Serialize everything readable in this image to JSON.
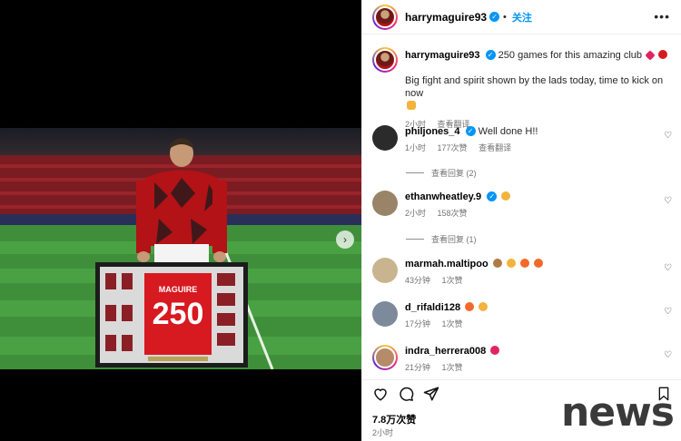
{
  "header": {
    "username": "harrymaguire93",
    "follow_label": "关注",
    "more_label": "•••"
  },
  "caption": {
    "username": "harrymaguire93",
    "headline": "250 games for this amazing club",
    "body": "Big fight and spirit shown by the lads today, time to kick on now",
    "time": "2小时",
    "translate": "查看翻译"
  },
  "comments": [
    {
      "username": "philjones_4",
      "text": "Well done H!!",
      "time": "1小时",
      "likes": "177次赞",
      "extra": "查看翻译",
      "replies": "查看回复 (2)"
    },
    {
      "username": "ethanwheatley.9",
      "text": "",
      "time": "2小时",
      "likes": "158次赞",
      "extra": "",
      "replies": "查看回复 (1)"
    },
    {
      "username": "marmah.maltipoo",
      "text": "",
      "time": "43分钟",
      "likes": "1次赞",
      "extra": ""
    },
    {
      "username": "d_rifaldi128",
      "text": "",
      "time": "17分钟",
      "likes": "1次赞",
      "extra": ""
    },
    {
      "username": "indra_herrera008",
      "text": "",
      "time": "21分钟",
      "likes": "1次赞",
      "extra": ""
    }
  ],
  "post": {
    "likes": "7.8万次赞",
    "time": "2小时"
  },
  "photo": {
    "shirt_name": "MAGUIRE",
    "shirt_number": "250"
  },
  "watermark": "news",
  "icons": {
    "heart": "heart-icon",
    "comment": "comment-icon",
    "share": "share-icon",
    "bookmark": "bookmark-icon",
    "next": "chevron-right-icon"
  },
  "colors": {
    "accent": "#0095f6",
    "heart_pink": "#e0245e",
    "muted": "#737373"
  }
}
